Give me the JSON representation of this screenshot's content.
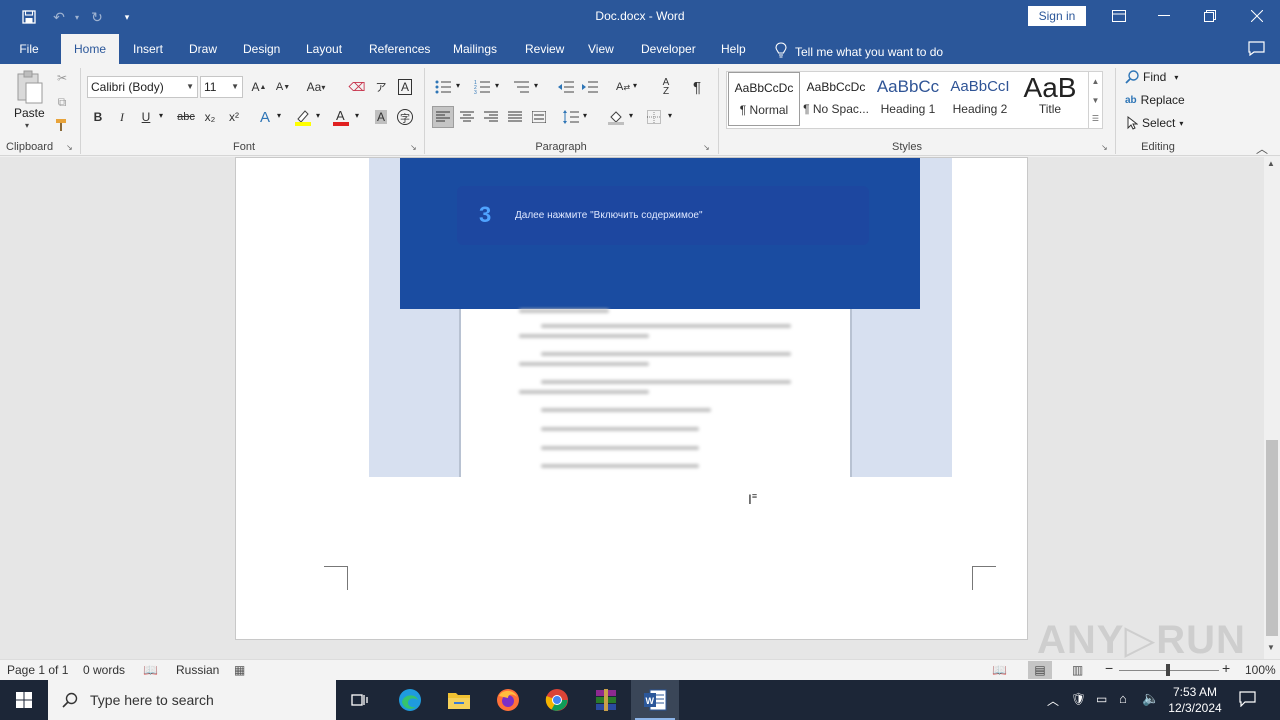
{
  "window": {
    "title": "Doc.docx  -  Word",
    "sign_in": "Sign in"
  },
  "tabs": [
    "File",
    "Home",
    "Insert",
    "Draw",
    "Design",
    "Layout",
    "References",
    "Mailings",
    "Review",
    "View",
    "Developer",
    "Help"
  ],
  "active_tab": "Home",
  "tell_me": "Tell me what you want to do",
  "ribbon": {
    "clipboard": {
      "label": "Clipboard",
      "paste": "Paste"
    },
    "font": {
      "label": "Font",
      "name": "Calibri (Body)",
      "size": "11",
      "bold": "B",
      "italic": "I",
      "underline": "U",
      "strikethrough": "abc",
      "subscript": "x₂",
      "superscript": "x²",
      "change_case": "Aa",
      "grow": "A",
      "shrink": "A"
    },
    "paragraph": {
      "label": "Paragraph",
      "pilcrow": "¶"
    },
    "styles": {
      "label": "Styles",
      "items": [
        {
          "sample": "AaBbCcDc",
          "name": "¶ Normal"
        },
        {
          "sample": "AaBbCcDc",
          "name": "¶ No Spac..."
        },
        {
          "sample": "AaBbCc",
          "name": "Heading 1"
        },
        {
          "sample": "AaBbCcI",
          "name": "Heading 2"
        },
        {
          "sample": "AaB",
          "name": "Title"
        }
      ]
    },
    "editing": {
      "label": "Editing",
      "find": "Find",
      "replace": "Replace",
      "select": "Select"
    }
  },
  "document": {
    "step_number": "3",
    "step_text": "Далее нажмите \"Включить содержимое\""
  },
  "status": {
    "page": "Page 1 of 1",
    "words": "0 words",
    "language": "Russian",
    "zoom": "100%"
  },
  "taskbar": {
    "search_placeholder": "Type here to search",
    "time": "7:53 AM",
    "date": "12/3/2024"
  },
  "watermark": "ANY RUN",
  "colors": {
    "word_blue": "#2b579a",
    "panel_blue": "#1a4ca1",
    "taskbar": "#1c2637"
  }
}
